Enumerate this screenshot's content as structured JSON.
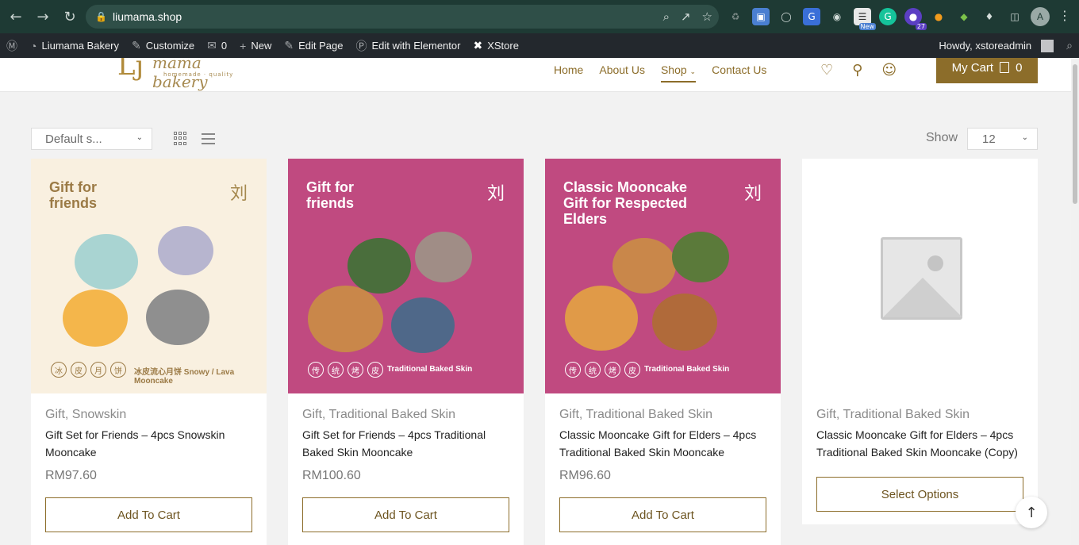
{
  "browser": {
    "url": "liumama.shop",
    "extensions": [
      "recycle-icon",
      "docs-icon",
      "globe-icon",
      "translate-icon",
      "camera-icon",
      "new-extension-icon",
      "grammarly-icon",
      "badge-27-icon",
      "orange-extension-icon",
      "color-extension-icon",
      "puzzle-icon"
    ],
    "new_badge": "New",
    "count_badge": "27",
    "profile_initial": "A"
  },
  "wp_admin_bar": {
    "site_name": "Liumama Bakery",
    "customize": "Customize",
    "comments_count": "0",
    "new": "New",
    "edit_page": "Edit Page",
    "edit_elementor": "Edit with Elementor",
    "xstore": "XStore",
    "howdy": "Howdy, xstoreadmin"
  },
  "header": {
    "logo_mark": "Lj",
    "logo_text": "mama bakery",
    "logo_tagline": "homemade · quality",
    "nav": [
      "Home",
      "About Us",
      "Shop",
      "Contact Us"
    ],
    "cart_label": "My Cart",
    "cart_count": "0"
  },
  "toolbar": {
    "sort_value": "Default s...",
    "show_label": "Show",
    "per_page": "12"
  },
  "products": [
    {
      "image_headline": "Gift for friends",
      "image_footer": "冰皮流心月饼 Snowy / Lava Mooncake",
      "image_stamps": [
        "冰",
        "皮",
        "月",
        "饼"
      ],
      "category": "Gift, Snowskin",
      "title": "Gift Set for Friends – 4pcs Snowskin Mooncake",
      "price": "RM97.60",
      "button": "Add To Cart"
    },
    {
      "image_headline": "Gift for friends",
      "image_footer": "Traditional Baked Skin",
      "image_stamps": [
        "传",
        "统",
        "烤",
        "皮"
      ],
      "category": "Gift, Traditional Baked Skin",
      "title": "Gift Set for Friends – 4pcs Traditional Baked Skin Mooncake",
      "price": "RM100.60",
      "button": "Add To Cart"
    },
    {
      "image_headline": "Classic Mooncake Gift for Respected Elders",
      "image_footer": "Traditional Baked Skin",
      "image_stamps": [
        "传",
        "统",
        "烤",
        "皮"
      ],
      "category": "Gift, Traditional Baked Skin",
      "title": "Classic Mooncake Gift for Elders – 4pcs Traditional Baked Skin Mooncake",
      "price": "RM96.60",
      "button": "Add To Cart"
    },
    {
      "category": "Gift, Traditional Baked Skin",
      "title": "Classic Mooncake Gift for Elders – 4pcs Traditional Baked Skin Mooncake (Copy)",
      "button": "Select Options"
    }
  ],
  "colors": {
    "brand_gold": "#8c6d2a",
    "browser_green": "#1e3a34",
    "magenta": "#c04a80"
  }
}
